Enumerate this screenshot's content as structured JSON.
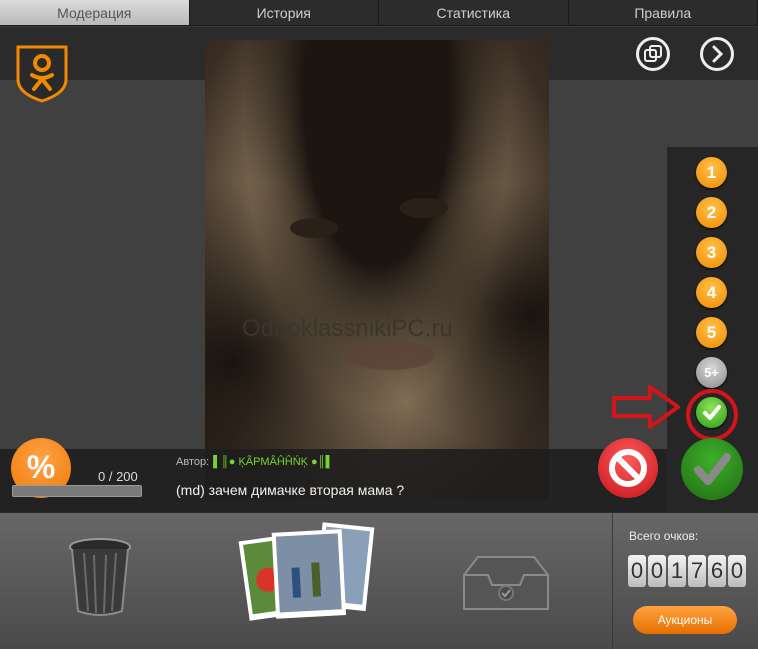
{
  "tabs": [
    {
      "label": "Модерация",
      "active": true
    },
    {
      "label": "История",
      "active": false
    },
    {
      "label": "Статистика",
      "active": false
    },
    {
      "label": "Правила",
      "active": false
    }
  ],
  "header": {
    "logo_icon": "odnoklassniki-logo-icon",
    "external_icon": "external-link-icon",
    "next_icon": "next-arrow-icon"
  },
  "watermark": "OdnoklassnikiPC.ru",
  "rating": {
    "options": [
      "1",
      "2",
      "3",
      "4",
      "5",
      "5+"
    ],
    "approve_small_icon": "check-icon"
  },
  "progress": {
    "text": "0 / 200",
    "current": 0,
    "total": 200
  },
  "percent_label": "%",
  "author": {
    "label": "Автор:",
    "name": "▌║● ĶÃРМÂĤĤŃĶ ●║▌"
  },
  "comment": "(md) зачем димачке вторая мама ?",
  "actions": {
    "block_icon": "block-icon",
    "approve_icon": "check-icon"
  },
  "toolbar": {
    "trash_icon": "trash-icon",
    "photos_icon": "photo-stack-icon",
    "inbox_icon": "inbox-tray-icon"
  },
  "score": {
    "label": "Всего очков:",
    "digits": [
      "0",
      "0",
      "1",
      "7",
      "6",
      "0"
    ]
  },
  "auction_label": "Аукционы",
  "colors": {
    "accent_orange": "#f08a00",
    "approve_green": "#2f9a17",
    "block_red": "#c5141a",
    "highlight_red": "#d4141b"
  }
}
